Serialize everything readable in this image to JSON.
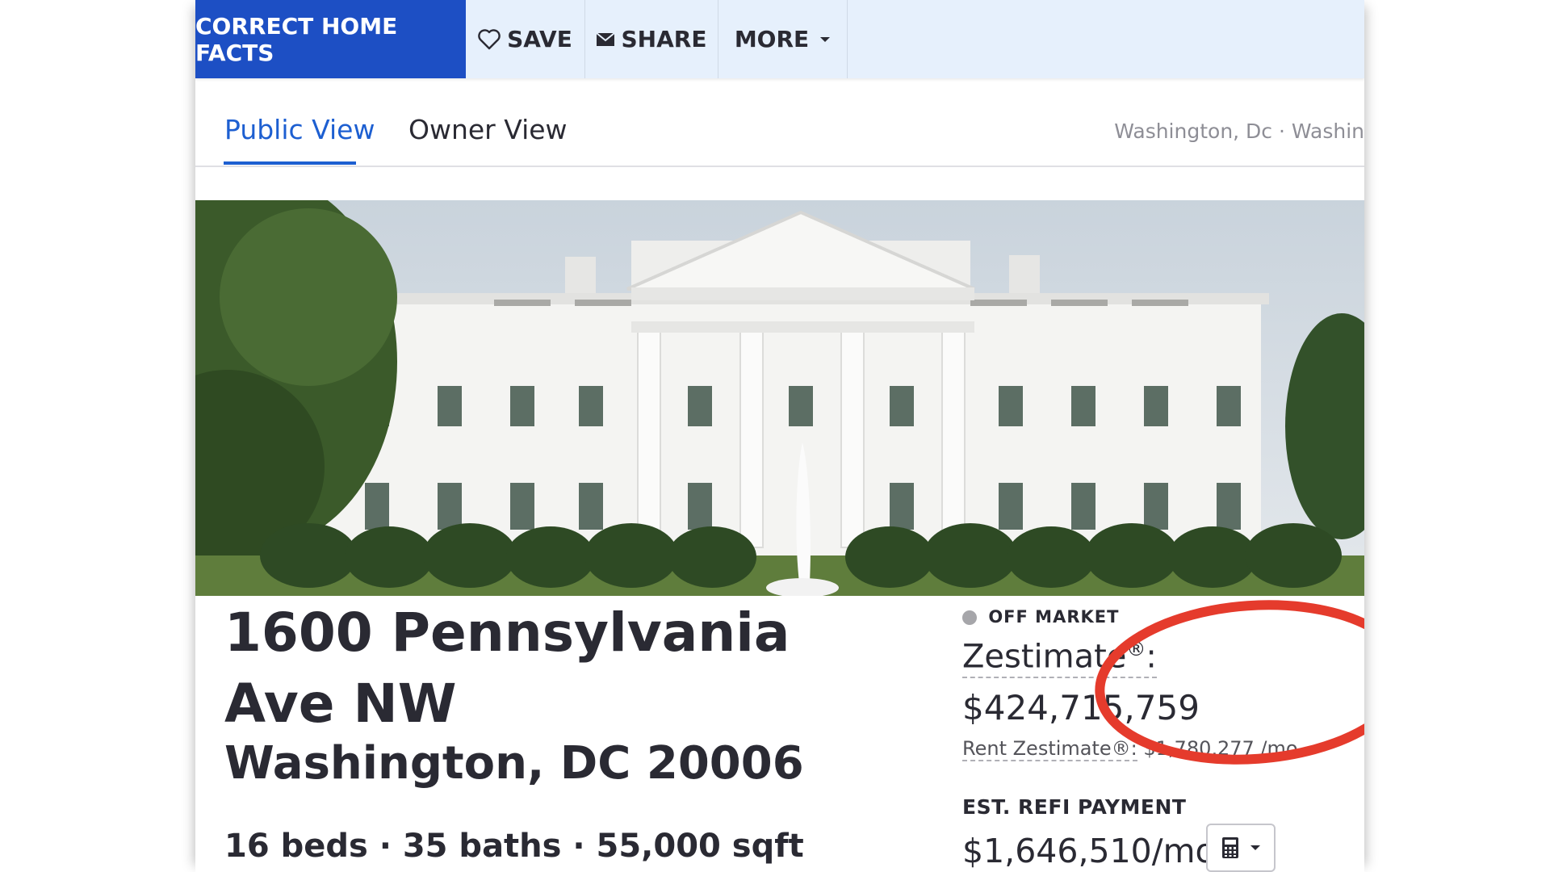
{
  "actions": {
    "correct": "CORRECT HOME FACTS",
    "save": "SAVE",
    "share": "SHARE",
    "more": "MORE"
  },
  "tabs": {
    "public": "Public View",
    "owner": "Owner View"
  },
  "breadcrumb": "Washington, Dc · Washin",
  "address": {
    "street": "1600 Pennsylvania Ave NW",
    "city_line": "Washington, DC 20006"
  },
  "facts": "16 beds · 35 baths · 55,000 sqft",
  "status": "OFF MARKET",
  "zestimate": {
    "label": "Zestimate",
    "reg": "®",
    "colon": ":",
    "value": "$424,715,759",
    "rent_label": "Rent Zestimate®:",
    "rent_value": " $1,780,277 /mo"
  },
  "refi": {
    "label": "EST. REFI PAYMENT",
    "value": "$1,646,510/mo"
  },
  "colors": {
    "primary": "#1d4fc4",
    "tab_active": "#1d5fd1",
    "annotation": "#e53b2c"
  },
  "icons": [
    "heart-icon",
    "mail-icon",
    "chevron-down-icon",
    "calculator-icon"
  ]
}
